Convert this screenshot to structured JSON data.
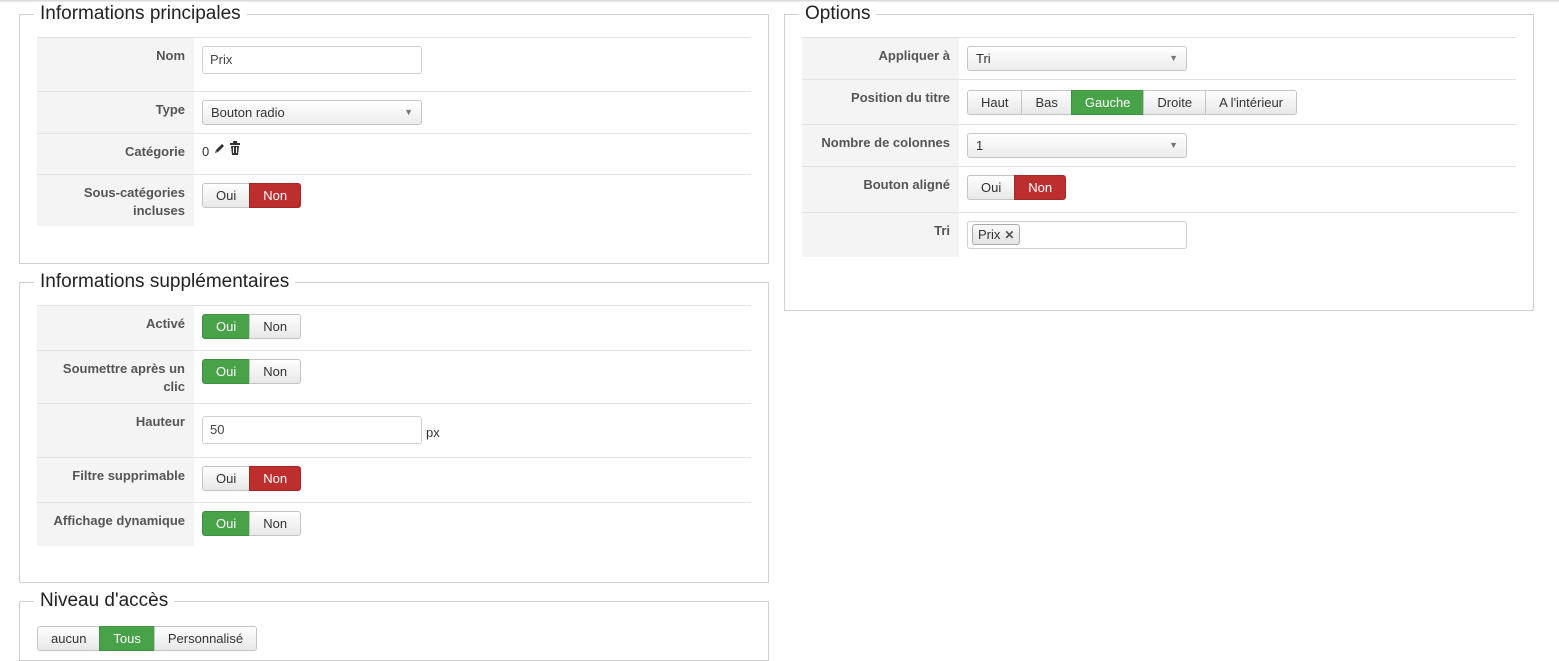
{
  "main_info": {
    "title": "Informations principales",
    "nom": {
      "label": "Nom",
      "value": "Prix"
    },
    "type": {
      "label": "Type",
      "value": "Bouton radio"
    },
    "categorie": {
      "label": "Catégorie",
      "value": "0"
    },
    "sous_categories": {
      "label": "Sous-catégories incluses",
      "options": [
        "Oui",
        "Non"
      ],
      "selected": "Non"
    }
  },
  "extra_info": {
    "title": "Informations supplémentaires",
    "active": {
      "label": "Activé",
      "options": [
        "Oui",
        "Non"
      ],
      "selected": "Oui"
    },
    "soumettre": {
      "label": "Soumettre après un clic",
      "options": [
        "Oui",
        "Non"
      ],
      "selected": "Oui"
    },
    "hauteur": {
      "label": "Hauteur",
      "value": "50",
      "unit": "px"
    },
    "filtre": {
      "label": "Filtre supprimable",
      "options": [
        "Oui",
        "Non"
      ],
      "selected": "Non"
    },
    "affichage": {
      "label": "Affichage dynamique",
      "options": [
        "Oui",
        "Non"
      ],
      "selected": "Oui"
    }
  },
  "access": {
    "title": "Niveau d'accès",
    "options": [
      "aucun",
      "Tous",
      "Personnalisé"
    ],
    "selected": "Tous"
  },
  "options": {
    "title": "Options",
    "appliquer": {
      "label": "Appliquer à",
      "value": "Tri"
    },
    "position": {
      "label": "Position du titre",
      "options": [
        "Haut",
        "Bas",
        "Gauche",
        "Droite",
        "A l'intérieur"
      ],
      "selected": "Gauche"
    },
    "colonnes": {
      "label": "Nombre de colonnes",
      "value": "1"
    },
    "bouton_aligne": {
      "label": "Bouton aligné",
      "options": [
        "Oui",
        "Non"
      ],
      "selected": "Non"
    },
    "tri": {
      "label": "Tri",
      "tags": [
        "Prix"
      ]
    }
  },
  "colors": {
    "active_green": "#47a248",
    "active_red": "#bd2f2f"
  },
  "icons": {
    "edit": "pencil-icon",
    "delete": "trash-icon",
    "remove_tag": "x-icon",
    "dropdown": "caret-down-icon"
  }
}
